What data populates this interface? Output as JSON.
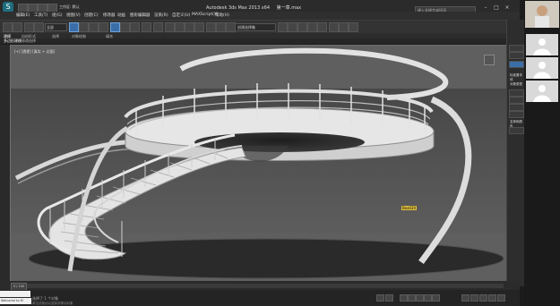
{
  "title_bar": {
    "app_title": "Autodesk 3ds Max  2013 x64",
    "file_name": "第一章.max",
    "workspace": "工作区: 默认",
    "search_placeholder": "键入关键字或短语"
  },
  "menu": [
    "编辑(E)",
    "工具(T)",
    "组(G)",
    "视图(V)",
    "创建(C)",
    "修改器",
    "动画",
    "图形编辑器",
    "渲染(R)",
    "自定义(U)",
    "MAXScript(X)",
    "帮助(H)"
  ],
  "toolbar": {
    "selection_filter": "全部",
    "named_selection": "创建选择集"
  },
  "ribbon": {
    "tabs": [
      "建模",
      "自由形式",
      "选择",
      "对象绘制",
      "填充"
    ],
    "sub": [
      "多边形建模",
      "修改选择"
    ],
    "active_index": 0
  },
  "viewport": {
    "label": "[+] [透视] [真实 + 边面]",
    "object_tag": "Box020"
  },
  "command_panel": {
    "items": [
      "标准基本体",
      "对象类型",
      "名称和颜色"
    ],
    "section": "名称和颜色"
  },
  "timeline": {
    "frame": "0 / 100"
  },
  "status": {
    "text": "选择了 1 个对象",
    "hint": "单击并拖动以选择并移动对象",
    "maxscript_label": "Welcome to M"
  },
  "colors": {
    "viewport_bg": "#5b5b5b",
    "ui_dark": "#2b2b2b",
    "accent": "#3a6ea8",
    "tag_yellow": "#e0c040"
  }
}
